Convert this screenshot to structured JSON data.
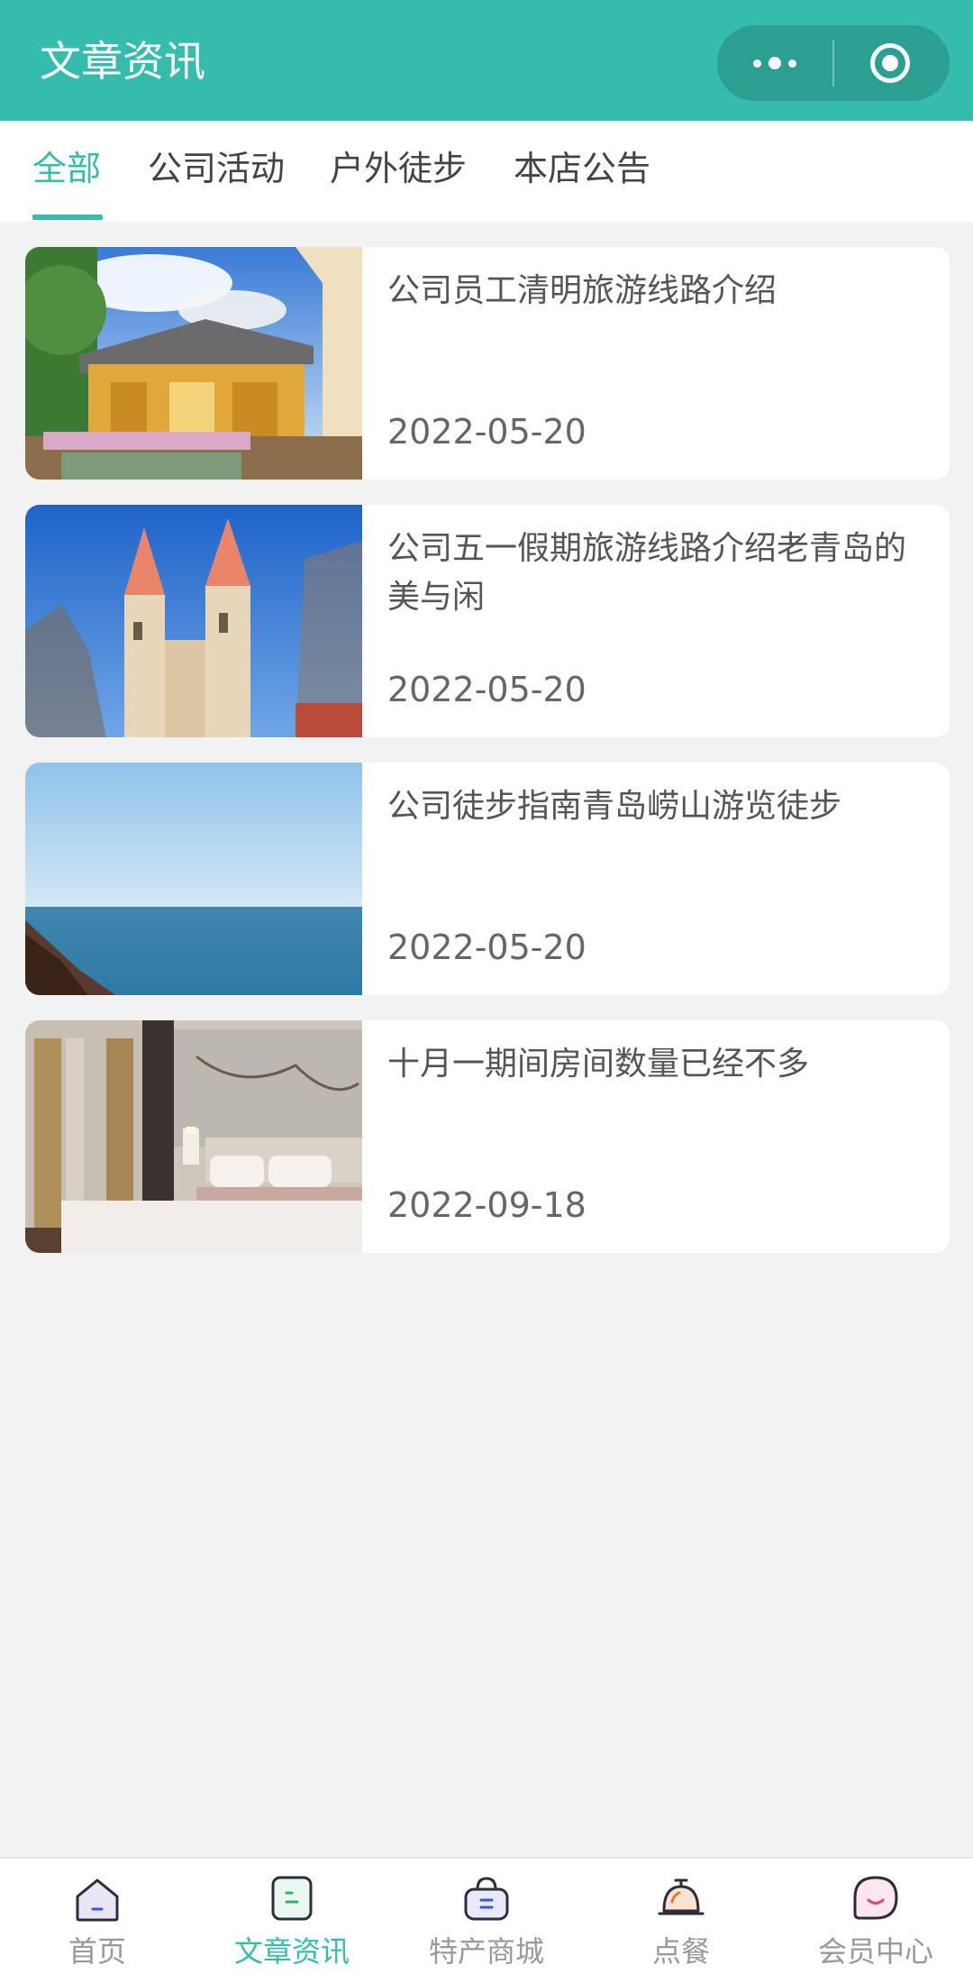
{
  "header": {
    "title": "文章资讯",
    "more_icon": "more-dots-icon",
    "close_icon": "target-circle-icon"
  },
  "tabs": [
    {
      "label": "全部",
      "active": true
    },
    {
      "label": "公司活动",
      "active": false
    },
    {
      "label": "户外徒步",
      "active": false
    },
    {
      "label": "本店公告",
      "active": false
    }
  ],
  "articles": [
    {
      "title": "公司员工清明旅游线路介绍",
      "date": "2022-05-20",
      "image": "courtyard-house-photo"
    },
    {
      "title": "公司五一假期旅游线路介绍老青岛的美与闲",
      "date": "2022-05-20",
      "image": "church-twin-spires-photo"
    },
    {
      "title": "公司徒步指南青岛崂山游览徒步",
      "date": "2022-05-20",
      "image": "sea-horizon-photo"
    },
    {
      "title": "十月一期间房间数量已经不多",
      "date": "2022-09-18",
      "image": "hotel-bedroom-photo"
    }
  ],
  "bottom_nav": [
    {
      "label": "首页",
      "icon": "home-icon",
      "active": false
    },
    {
      "label": "文章资讯",
      "icon": "article-icon",
      "active": true
    },
    {
      "label": "特产商城",
      "icon": "shop-bag-icon",
      "active": false
    },
    {
      "label": "点餐",
      "icon": "dining-bell-icon",
      "active": false
    },
    {
      "label": "会员中心",
      "icon": "member-smile-icon",
      "active": false
    }
  ],
  "colors": {
    "accent": "#36bcad",
    "background": "#f2f2f3"
  }
}
